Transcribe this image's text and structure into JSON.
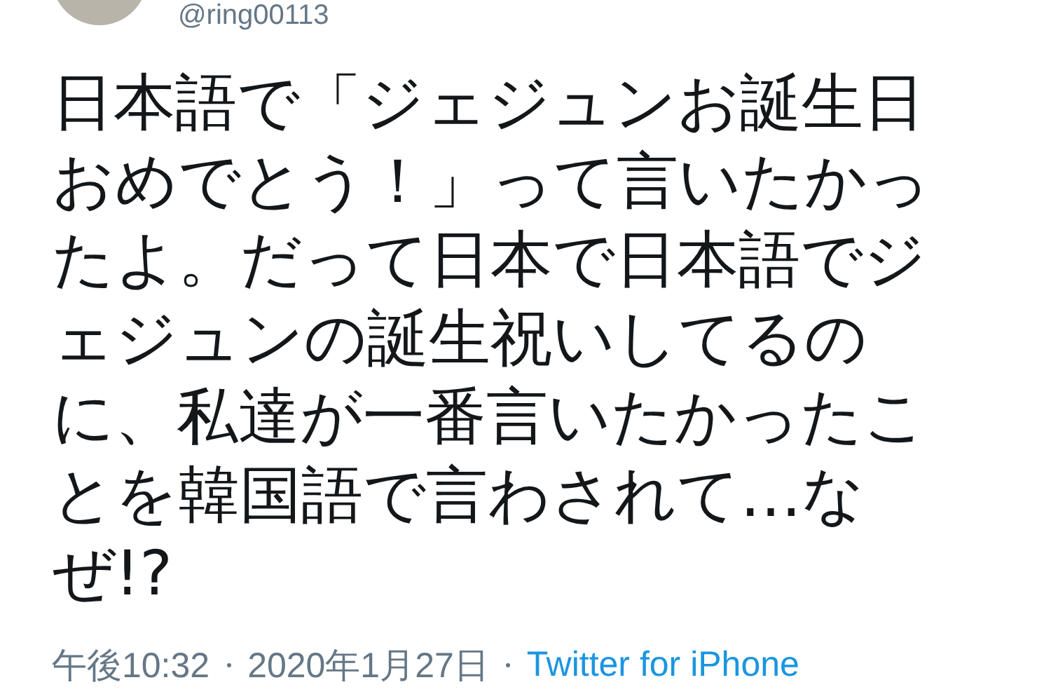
{
  "author": {
    "handle": "@ring00113"
  },
  "tweet": {
    "text": "日本語で「ジェジュンお誕生日おめでとう！」って言いたかったよ。だって日本で日本語でジェジュンの誕生祝いしてるのに、私達が一番言いたかったことを韓国語で言わされて…なぜ!?"
  },
  "meta": {
    "time": "午後10:32",
    "date": "2020年1月27日",
    "source": "Twitter for iPhone"
  }
}
